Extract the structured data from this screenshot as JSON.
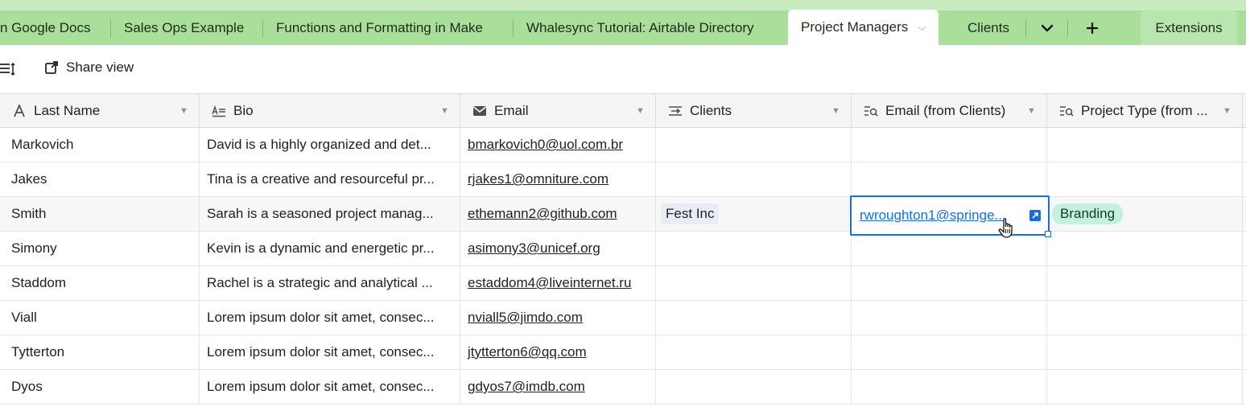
{
  "tabs": [
    {
      "label": "n Google Docs"
    },
    {
      "label": "Sales Ops Example"
    },
    {
      "label": "Functions and Formatting in Make"
    },
    {
      "label": "Whalesync Tutorial: Airtable Directory"
    },
    {
      "label": "Project Managers"
    },
    {
      "label": "Clients"
    }
  ],
  "tab_overflow_icon": "chevron-down-icon",
  "add_tab_icon": "plus-icon",
  "extensions_label": "Extensions",
  "toolbar": {
    "share_label": "Share view"
  },
  "columns": [
    {
      "label": "Last Name",
      "icon": "text-icon"
    },
    {
      "label": "Bio",
      "icon": "long-text-icon"
    },
    {
      "label": "Email",
      "icon": "email-icon"
    },
    {
      "label": "Clients",
      "icon": "link-icon"
    },
    {
      "label": "Email (from Clients)",
      "icon": "lookup-icon"
    },
    {
      "label": "Project Type (from ...",
      "icon": "lookup-icon"
    }
  ],
  "rows": [
    {
      "last_name": "Markovich",
      "bio": "David is a highly organized and det...",
      "email": "bmarkovich0@uol.com.br",
      "clients": "",
      "client_email": "",
      "project_type": ""
    },
    {
      "last_name": "Jakes",
      "bio": "Tina is a creative and resourceful pr...",
      "email": "rjakes1@omniture.com",
      "clients": "",
      "client_email": "",
      "project_type": ""
    },
    {
      "last_name": "Smith",
      "bio": "Sarah is a seasoned project manag...",
      "email": "ethemann2@github.com",
      "clients": "Fest Inc",
      "client_email": "rwroughton1@springe...",
      "project_type": "Branding"
    },
    {
      "last_name": "Simony",
      "bio": "Kevin is a dynamic and energetic pr...",
      "email": "asimony3@unicef.org",
      "clients": "",
      "client_email": "",
      "project_type": ""
    },
    {
      "last_name": "Staddom",
      "bio": "Rachel is a strategic and analytical ...",
      "email": "estaddom4@liveinternet.ru",
      "clients": "",
      "client_email": "",
      "project_type": ""
    },
    {
      "last_name": "Viall",
      "bio": "Lorem ipsum dolor sit amet, consec...",
      "email": "nviall5@jimdo.com",
      "clients": "",
      "client_email": "",
      "project_type": ""
    },
    {
      "last_name": "Tytterton",
      "bio": "Lorem ipsum dolor sit amet, consec...",
      "email": "jtytterton6@qq.com",
      "clients": "",
      "client_email": "",
      "project_type": ""
    },
    {
      "last_name": "Dyos",
      "bio": "Lorem ipsum dolor sit amet, consec...",
      "email": "gdyos7@imdb.com",
      "clients": "",
      "client_email": "",
      "project_type": ""
    }
  ],
  "colors": {
    "accent": "#166ee1",
    "tab_bar": "#a9df9a",
    "pill": "#c2f1de",
    "chip": "#e8edf3"
  }
}
